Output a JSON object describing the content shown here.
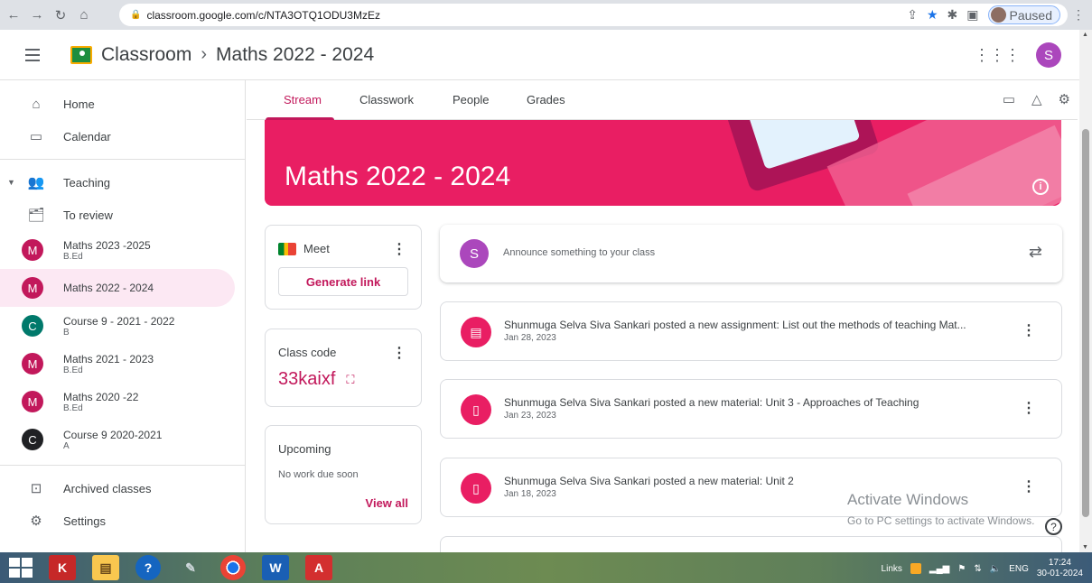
{
  "browser": {
    "url": "classroom.google.com/c/NTA3OTQ1ODU3MzEz",
    "paused_label": "Paused"
  },
  "header": {
    "app_name": "Classroom",
    "separator": "›",
    "class_name": "Maths 2022 - 2024",
    "user_initial": "S"
  },
  "sidebar": {
    "home": "Home",
    "calendar": "Calendar",
    "teaching": "Teaching",
    "to_review": "To review",
    "classes": [
      {
        "initial": "M",
        "title": "Maths 2023 -2025",
        "subtitle": "B.Ed",
        "color": "#c2185b"
      },
      {
        "initial": "M",
        "title": "Maths 2022 - 2024",
        "subtitle": "",
        "color": "#c2185b"
      },
      {
        "initial": "C",
        "title": "Course 9 - 2021 - 2022",
        "subtitle": "B",
        "color": "#00796b"
      },
      {
        "initial": "M",
        "title": "Maths 2021 - 2023",
        "subtitle": "B.Ed",
        "color": "#c2185b"
      },
      {
        "initial": "M",
        "title": "Maths 2020 -22",
        "subtitle": "B.Ed",
        "color": "#c2185b"
      },
      {
        "initial": "C",
        "title": "Course 9 2020-2021",
        "subtitle": "A",
        "color": "#202124"
      }
    ],
    "archived": "Archived classes",
    "settings": "Settings"
  },
  "tabs": {
    "stream": "Stream",
    "classwork": "Classwork",
    "people": "People",
    "grades": "Grades"
  },
  "banner": {
    "title": "Maths 2022 - 2024",
    "info": "i"
  },
  "meet": {
    "label": "Meet",
    "button": "Generate link"
  },
  "class_code": {
    "title": "Class code",
    "value": "33kaixf"
  },
  "upcoming": {
    "title": "Upcoming",
    "empty": "No work due soon",
    "view_all": "View all"
  },
  "announce": {
    "initial": "S",
    "placeholder": "Announce something to your class"
  },
  "posts": [
    {
      "text": "Shunmuga Selva Siva Sankari posted a new assignment: List out the methods of teaching Mat...",
      "date": "Jan 28, 2023"
    },
    {
      "text": "Shunmuga Selva Siva Sankari posted a new material: Unit 3 - Approaches of Teaching",
      "date": "Jan 23, 2023"
    },
    {
      "text": "Shunmuga Selva Siva Sankari posted a new material: Unit 2",
      "date": "Jan 18, 2023"
    }
  ],
  "watermark": {
    "line1": "Activate Windows",
    "line2": "Go to PC settings to activate Windows."
  },
  "taskbar": {
    "links": "Links",
    "lang": "ENG",
    "time": "17:24",
    "date": "30-01-2024"
  },
  "colors": {
    "accent": "#c2185b",
    "banner": "#e91e63"
  }
}
